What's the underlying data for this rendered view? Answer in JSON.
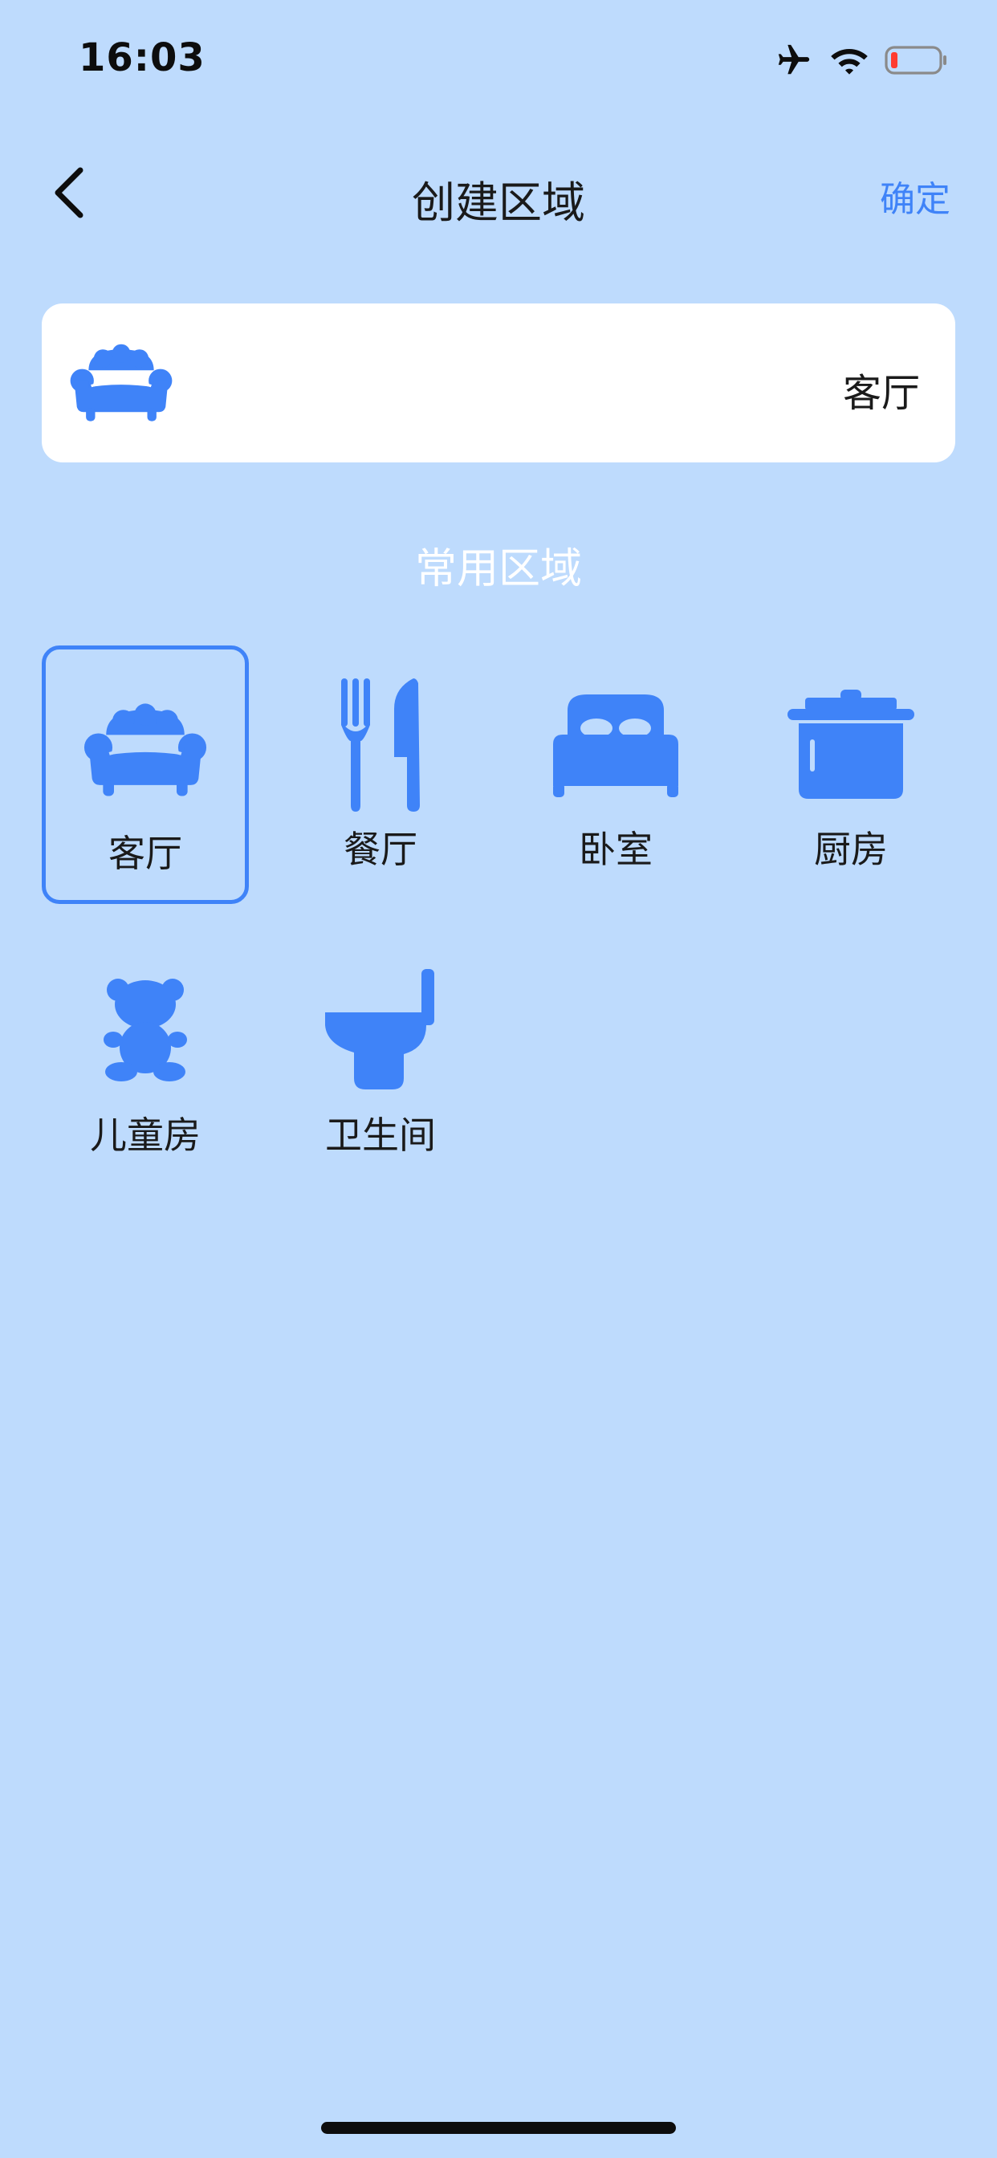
{
  "status_bar": {
    "time": "16:03"
  },
  "nav": {
    "title": "创建区域",
    "confirm_label": "确定"
  },
  "selected_card": {
    "icon": "sofa-icon",
    "label": "客厅"
  },
  "section_title": "常用区域",
  "areas": [
    {
      "label": "客厅",
      "icon": "sofa-icon",
      "selected": true
    },
    {
      "label": "餐厅",
      "icon": "fork-knife-icon",
      "selected": false
    },
    {
      "label": "卧室",
      "icon": "bed-icon",
      "selected": false
    },
    {
      "label": "厨房",
      "icon": "pot-icon",
      "selected": false
    },
    {
      "label": "儿童房",
      "icon": "teddy-bear-icon",
      "selected": false
    },
    {
      "label": "卫生间",
      "icon": "toilet-icon",
      "selected": false
    }
  ],
  "colors": {
    "background": "#bedbfd",
    "accent": "#3f83f8",
    "battery_low": "#ff3b30"
  }
}
